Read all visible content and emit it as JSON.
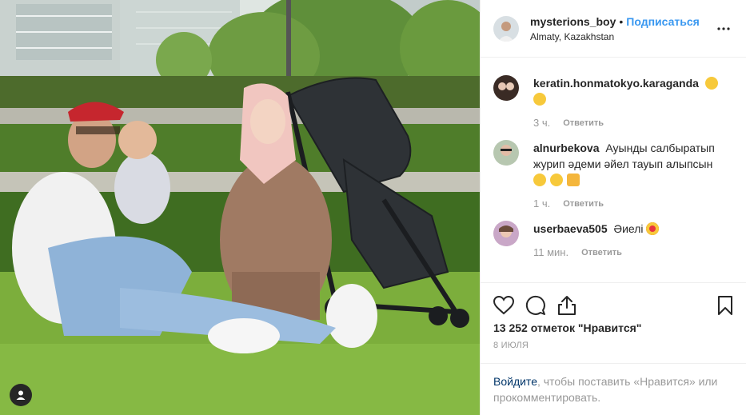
{
  "post": {
    "author": {
      "username": "mysterions_boy",
      "follow_label": "Подписаться",
      "separator": "•",
      "location": "Almaty, Kazakhstan"
    },
    "more_icon": "more-horizontal-icon",
    "comments": [
      {
        "username": "keratin.honmatokyo.karaganda",
        "text": "",
        "emojis": [
          "grinning-squint-emoji",
          "grinning-squint-emoji"
        ],
        "time": "3 ч.",
        "reply_label": "Ответить"
      },
      {
        "username": "alnurbekova",
        "text": "Ауынды салбыратып журип әдеми әйел тауып алыпсын",
        "emojis": [
          "smiling-emoji",
          "smiling-emoji",
          "thumbs-up-emoji"
        ],
        "time": "1 ч.",
        "reply_label": "Ответить"
      },
      {
        "username": "userbaeva505",
        "text": "Әиелі",
        "emojis": [
          "heart-eyes-emoji"
        ],
        "time": "11 мин.",
        "reply_label": "Ответить"
      }
    ],
    "likes": "13 252 отметок \"Нравится\"",
    "date": "8 ИЮЛЯ",
    "login_prompt": {
      "link": "Войдите",
      "rest": ", чтобы поставить «Нравится» или прокомментировать."
    },
    "colors": {
      "link_blue": "#3897f0",
      "login_blue": "#003569",
      "muted": "#999999",
      "text": "#262626"
    }
  }
}
